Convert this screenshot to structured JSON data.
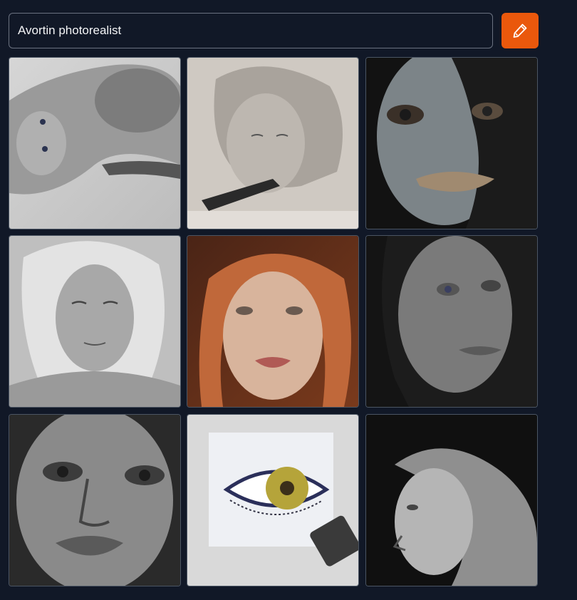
{
  "prompt": {
    "value": "Avortin photorealist"
  },
  "edit_button": {
    "icon": "pencil-icon",
    "color": "#ea580c"
  },
  "images": [
    {
      "subject": "graphite reclining figure"
    },
    {
      "subject": "pencil drawing of woman with blade"
    },
    {
      "subject": "dark shadowed face portrait"
    },
    {
      "subject": "pale blonde woman portrait"
    },
    {
      "subject": "red-haired woman painting"
    },
    {
      "subject": "dark woman face sketch"
    },
    {
      "subject": "monochrome close-up face"
    },
    {
      "subject": "painted yellow eye"
    },
    {
      "subject": "woman profile in dark"
    }
  ]
}
